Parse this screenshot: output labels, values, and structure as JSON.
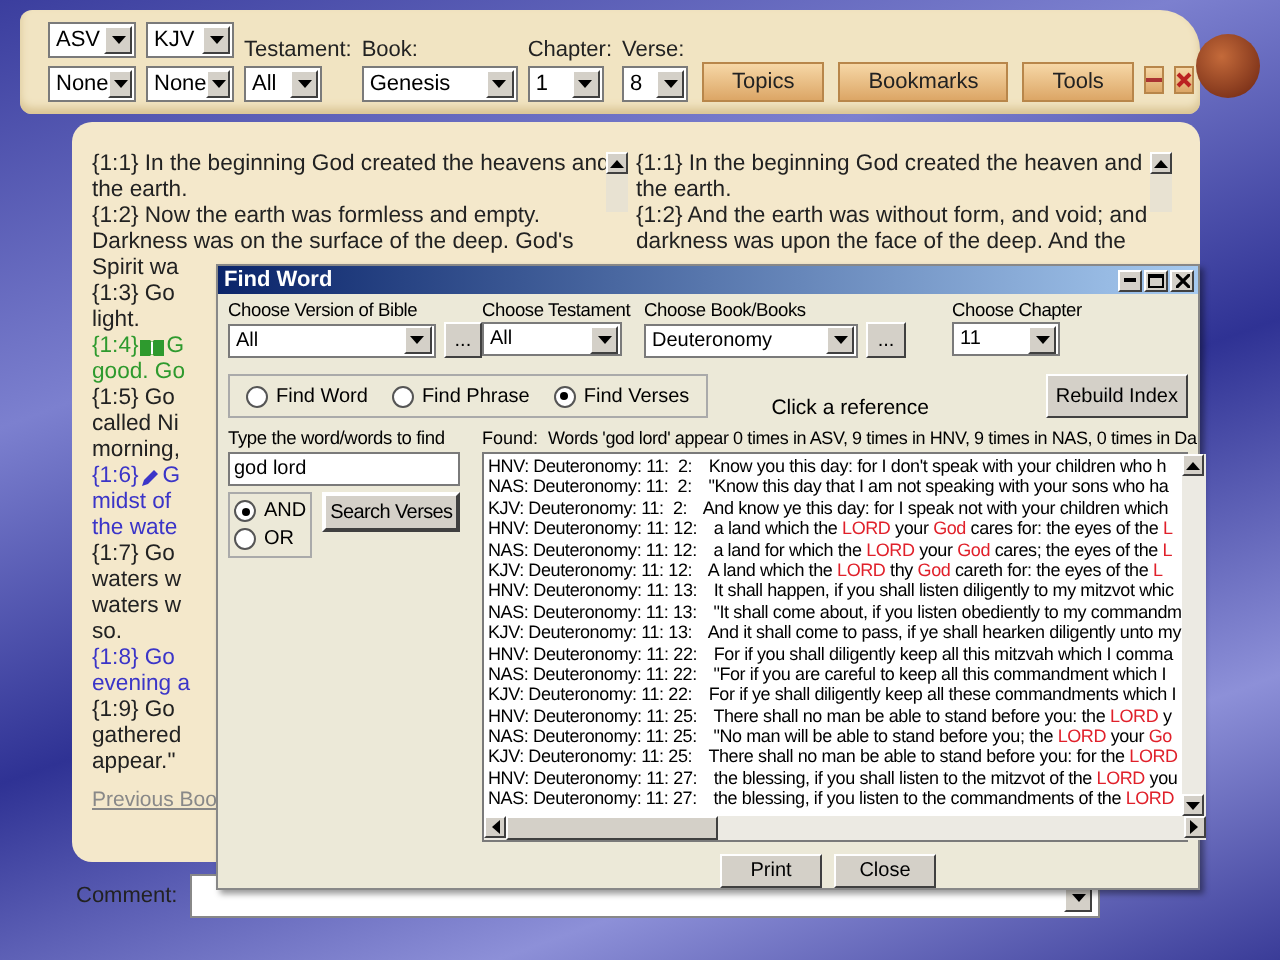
{
  "toolbar": {
    "primary_versions": [
      "ASV",
      "KJV"
    ],
    "secondary_versions": [
      "None",
      "None"
    ],
    "filters": [
      {
        "label": "Testament:",
        "value": "All"
      },
      {
        "label": "Book:",
        "value": "Genesis"
      },
      {
        "label": "Chapter:",
        "value": "1"
      },
      {
        "label": "Verse:",
        "value": "8"
      }
    ],
    "buttons": [
      "Topics",
      "Bookmarks",
      "Tools"
    ]
  },
  "reading": {
    "panels": [
      {
        "lines": [
          {
            "text": "{1:1} In the beginning God created the heavens and",
            "color": "#222222"
          },
          {
            "text": "the earth.",
            "color": "#222222"
          },
          {
            "text": "{1:2} Now the earth was formless and empty.",
            "color": "#222222"
          },
          {
            "text": "Darkness was on the surface of the deep. God's",
            "color": "#222222"
          },
          {
            "text": "Spirit wa",
            "color": "#222222"
          },
          {
            "text": "{1:3} Go",
            "color": "#222222"
          },
          {
            "text": "light.",
            "color": "#222222"
          },
          {
            "text": "{1:4}",
            "kind": "book",
            "after": "G",
            "color": "#2e9a2e"
          },
          {
            "text": "good. Go",
            "color": "#2e9a2e"
          },
          {
            "text": "{1:5} Go",
            "color": "#222222"
          },
          {
            "text": "called Ni",
            "color": "#222222"
          },
          {
            "text": "morning,",
            "color": "#222222"
          },
          {
            "text": "{1:6}",
            "kind": "pen",
            "after": "G",
            "color": "#3b35c8"
          },
          {
            "text": "midst of",
            "color": "#3b35c8"
          },
          {
            "text": "the wate",
            "color": "#3b35c8"
          },
          {
            "text": "{1:7} Go",
            "color": "#222222"
          },
          {
            "text": "waters w",
            "color": "#222222"
          },
          {
            "text": "waters w",
            "color": "#222222"
          },
          {
            "text": "so.",
            "color": "#222222"
          },
          {
            "text": "{1:8} Go",
            "color": "#3b35c8"
          },
          {
            "text": "evening a",
            "color": "#3b35c8"
          },
          {
            "text": "{1:9} Go",
            "color": "#222222"
          },
          {
            "text": "gathered",
            "color": "#222222"
          },
          {
            "text": "appear.\"",
            "color": "#222222"
          }
        ]
      },
      {
        "lines": [
          {
            "text": "{1:1} In the beginning God created the heaven and",
            "color": "#222222"
          },
          {
            "text": "the earth.",
            "color": "#222222"
          },
          {
            "text": "{1:2} And the earth was without form, and void; and",
            "color": "#222222"
          },
          {
            "text": "darkness was upon the face of the deep. And the",
            "color": "#222222"
          }
        ]
      }
    ],
    "link": "Previous Boo"
  },
  "find_dialog": {
    "title": "Find Word",
    "filters": [
      {
        "label": "Choose Version of Bible",
        "value": "All",
        "browse": "..."
      },
      {
        "label": "Choose Testament",
        "value": "All"
      },
      {
        "label": "Choose Book/Books",
        "value": "Deuteronomy",
        "browse": "..."
      },
      {
        "label": "Choose Chapter",
        "value": "11"
      }
    ],
    "modes": [
      {
        "label": "Find Word",
        "selected": false
      },
      {
        "label": "Find Phrase",
        "selected": false
      },
      {
        "label": "Find Verses",
        "selected": true
      }
    ],
    "hint": "Click a reference",
    "rebuild_button": "Rebuild Index",
    "query_label": "Type the word/words to find",
    "query": "god lord",
    "operators": [
      {
        "label": "AND",
        "selected": true
      },
      {
        "label": "OR",
        "selected": false
      }
    ],
    "search_button": "Search Verses",
    "found_label": "Found:",
    "found_summary": "Words 'god lord' appear 0 times in ASV, 9 times in HNV, 9 times in NAS, 0 times in Da",
    "results": [
      {
        "ref": "HNV: Deuteronomy: 11:  2:",
        "segments": [
          {
            "text": "Know you this day: for I don't speak with your children who h",
            "highlight": false
          }
        ]
      },
      {
        "ref": "NAS: Deuteronomy: 11:  2:",
        "segments": [
          {
            "text": "\"Know this day that I am not speaking with your sons who ha",
            "highlight": false
          }
        ]
      },
      {
        "ref": "KJV: Deuteronomy: 11:  2:",
        "segments": [
          {
            "text": "And know ye this day: for I speak not with your children which",
            "highlight": false
          }
        ]
      },
      {
        "ref": "HNV: Deuteronomy: 11: 12:",
        "segments": [
          {
            "text": "a land which the ",
            "highlight": false
          },
          {
            "text": "LORD",
            "highlight": true
          },
          {
            "text": " your ",
            "highlight": false
          },
          {
            "text": "God",
            "highlight": true
          },
          {
            "text": " cares for: the eyes of the ",
            "highlight": false
          },
          {
            "text": "L",
            "highlight": true
          }
        ]
      },
      {
        "ref": "NAS: Deuteronomy: 11: 12:",
        "segments": [
          {
            "text": "a land for which the ",
            "highlight": false
          },
          {
            "text": "LORD",
            "highlight": true
          },
          {
            "text": " your ",
            "highlight": false
          },
          {
            "text": "God",
            "highlight": true
          },
          {
            "text": " cares; the eyes of the ",
            "highlight": false
          },
          {
            "text": "L",
            "highlight": true
          }
        ]
      },
      {
        "ref": "KJV: Deuteronomy: 11: 12:",
        "segments": [
          {
            "text": "A land which the ",
            "highlight": false
          },
          {
            "text": "LORD",
            "highlight": true
          },
          {
            "text": " thy ",
            "highlight": false
          },
          {
            "text": "God",
            "highlight": true
          },
          {
            "text": " careth for: the eyes of the ",
            "highlight": false
          },
          {
            "text": "L",
            "highlight": true
          }
        ]
      },
      {
        "ref": "HNV: Deuteronomy: 11: 13:",
        "segments": [
          {
            "text": "It shall happen, if you shall listen diligently to my mitzvot whic",
            "highlight": false
          }
        ]
      },
      {
        "ref": "NAS: Deuteronomy: 11: 13:",
        "segments": [
          {
            "text": "\"It shall come about, if you listen obediently to my commandm",
            "highlight": false
          }
        ]
      },
      {
        "ref": "KJV: Deuteronomy: 11: 13:",
        "segments": [
          {
            "text": "And it shall come to pass, if ye shall hearken diligently unto my",
            "highlight": false
          }
        ]
      },
      {
        "ref": "HNV: Deuteronomy: 11: 22:",
        "segments": [
          {
            "text": "For if you shall diligently keep all this mitzvah which I comma",
            "highlight": false
          }
        ]
      },
      {
        "ref": "NAS: Deuteronomy: 11: 22:",
        "segments": [
          {
            "text": "\"For if you are careful to keep all this commandment which I",
            "highlight": false
          }
        ]
      },
      {
        "ref": "KJV: Deuteronomy: 11: 22:",
        "segments": [
          {
            "text": "For if ye shall diligently keep all these commandments which I",
            "highlight": false
          }
        ]
      },
      {
        "ref": "HNV: Deuteronomy: 11: 25:",
        "segments": [
          {
            "text": "There shall no man be able to stand before you: the ",
            "highlight": false
          },
          {
            "text": "LORD",
            "highlight": true
          },
          {
            "text": " y",
            "highlight": false
          }
        ]
      },
      {
        "ref": "NAS: Deuteronomy: 11: 25:",
        "segments": [
          {
            "text": "\"No man will be able to stand before you; the ",
            "highlight": false
          },
          {
            "text": "LORD",
            "highlight": true
          },
          {
            "text": " your ",
            "highlight": false
          },
          {
            "text": "Go",
            "highlight": true
          }
        ]
      },
      {
        "ref": "KJV: Deuteronomy: 11: 25:",
        "segments": [
          {
            "text": "There shall no man be able to stand before you: for the ",
            "highlight": false
          },
          {
            "text": "LORD",
            "highlight": true
          }
        ]
      },
      {
        "ref": "HNV: Deuteronomy: 11: 27:",
        "segments": [
          {
            "text": "the blessing, if you shall listen to the mitzvot of the ",
            "highlight": false
          },
          {
            "text": "LORD",
            "highlight": true
          },
          {
            "text": " you",
            "highlight": false
          }
        ]
      },
      {
        "ref": "NAS: Deuteronomy: 11: 27:",
        "segments": [
          {
            "text": "the blessing, if you listen to the commandments of the ",
            "highlight": false
          },
          {
            "text": "LORD",
            "highlight": true
          }
        ]
      }
    ],
    "buttons": [
      "Print",
      "Close"
    ]
  },
  "comment": {
    "label": "Comment:"
  }
}
